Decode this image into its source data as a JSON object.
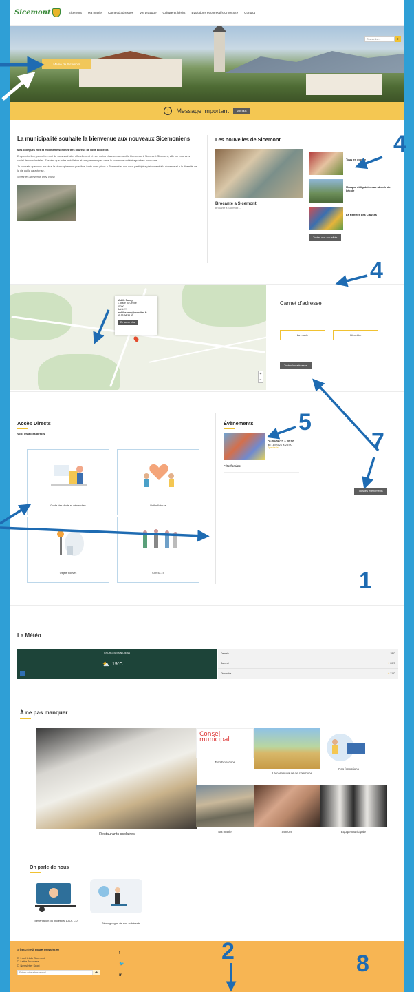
{
  "header": {
    "logo_text": "Sicemont",
    "nav": [
      "Sicemont",
      "Ma mairie",
      "Carnet d'adresses",
      "Vie pratique",
      "Culture et loisirs",
      "Evolutions et correctifs CmonSite",
      "Contact"
    ]
  },
  "hero": {
    "search_placeholder": "Recherche...",
    "mairie_button": "Mairie de Sicemont"
  },
  "alert": {
    "text": "Message important",
    "button": "Voir plus"
  },
  "welcome": {
    "title": "La municipalité souhaite la bienvenue aux nouveaux Sicemoniens",
    "lead": "Mes collègues élus et moi-même sommes très heureux de vous accueillir.",
    "p1": "En premier lieu, permettez-moi de vous souhaiter officiellement et non moins chaleureusement la bienvenue à Sicemont. Sicemont, ville où vous avez choisi de vous installer. J'espère que votre installation et vos premiers pas dans la commune ont été agréables pour vous.",
    "p2": "Je souhaite que vous trouviez, le plus rapidement possible, toute votre place à Sicemont et que vous participiez pleinement à la richesse et à la diversité de la vie qui la caractérise.",
    "p3": "Soyez les bienvenus chez vous !"
  },
  "news": {
    "title": "Les nouvelles de Sicemont",
    "main_title": "Brocante a Sicemont",
    "main_sub": "Brocante à Sicemont ...",
    "side": [
      {
        "title": "Tous en équipe"
      },
      {
        "title": "Masque obligatoire aux abords de l'école"
      },
      {
        "title": "La Rentrée des Classes"
      }
    ],
    "all_button": "Toutes nos actualités"
  },
  "map": {
    "popup_name": "Mobile Sunny",
    "popup_l1": "1, place du Centre",
    "popup_l2": "31200",
    "popup_l3": "BAKLEY",
    "popup_email": "mobilesunny@monsites.fr",
    "popup_phone": "01 02 06 24 07",
    "popup_button": "En savoir plus",
    "zoom_in": "+",
    "zoom_out": "−"
  },
  "carnet": {
    "title": "Carnet d'adresse",
    "btn1": "La mairie",
    "btn2": "Bien-être",
    "all_button": "Toutes les adresses"
  },
  "acces": {
    "title": "Accès Directs",
    "sub": "Voici les accès directs",
    "tiles": [
      "Guide des droits et démarches",
      "Défibrillateurs",
      "Objets trouvés",
      "COVID-19"
    ]
  },
  "events": {
    "title": "Évènements",
    "date1": "Du 05/06/21 à 20:00",
    "date2": "au 18/09/21 à 23:00",
    "cat": "Spectacle",
    "name": "Fête foraine",
    "all_button": "Tous les évènements"
  },
  "meteo": {
    "title": "La Météo",
    "city": "CHORGES SAINT-JEAN",
    "temp": "19°C",
    "rows": [
      {
        "day": "Demain",
        "temp": "18°C"
      },
      {
        "day": "Samedi",
        "temp": "20°C"
      },
      {
        "day": "Dimanche",
        "temp": "21°C"
      }
    ]
  },
  "npm": {
    "title": "À ne pas manquer",
    "big_label": "Restaurants scolaires",
    "labels": [
      "Trombinoscope",
      "La communauté de commune",
      "Nos formations",
      "Ma mairie",
      "Seniors",
      "Equipe Municipale"
    ],
    "conseil": "Conseil municipal"
  },
  "opdn": {
    "title": "On parle de nous",
    "items": [
      "présentation du projet par ATOL CD",
      "Témoignages de nos adhérents"
    ]
  },
  "footer": {
    "title": "S'inscrire à notre newsletter",
    "options": [
      "Info Hebdo Sicemont",
      "Lettre Jeunesse",
      "Newsletter Sport"
    ],
    "email_placeholder": "Entrez votre adresse mail",
    "submit": "➔",
    "social": [
      "f",
      "🐦",
      "in"
    ]
  },
  "annotations": [
    "4",
    "4",
    "5",
    "7",
    "1",
    "2",
    "8"
  ]
}
